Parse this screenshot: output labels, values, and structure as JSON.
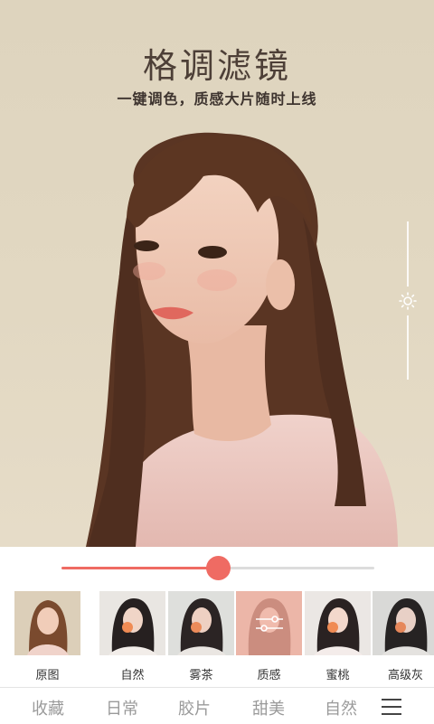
{
  "banner": {
    "title": "格调滤镜",
    "subtitle": "一键调色，质感大片随时上线"
  },
  "brightness": {
    "icon": "sun-icon",
    "level": 0.5
  },
  "intensity": {
    "value": 0.5,
    "accent": "#ef6b63"
  },
  "filters": [
    {
      "label": "原图"
    },
    {
      "label": "自然"
    },
    {
      "label": "雾茶"
    },
    {
      "label": "质感",
      "selected": true,
      "icon": "adjust-sliders-icon"
    },
    {
      "label": "蜜桃"
    },
    {
      "label": "高级灰"
    }
  ],
  "tabs": [
    {
      "label": "收藏"
    },
    {
      "label": "日常"
    },
    {
      "label": "胶片"
    },
    {
      "label": "甜美"
    },
    {
      "label": "自然"
    }
  ],
  "menu_icon": "menu-icon"
}
